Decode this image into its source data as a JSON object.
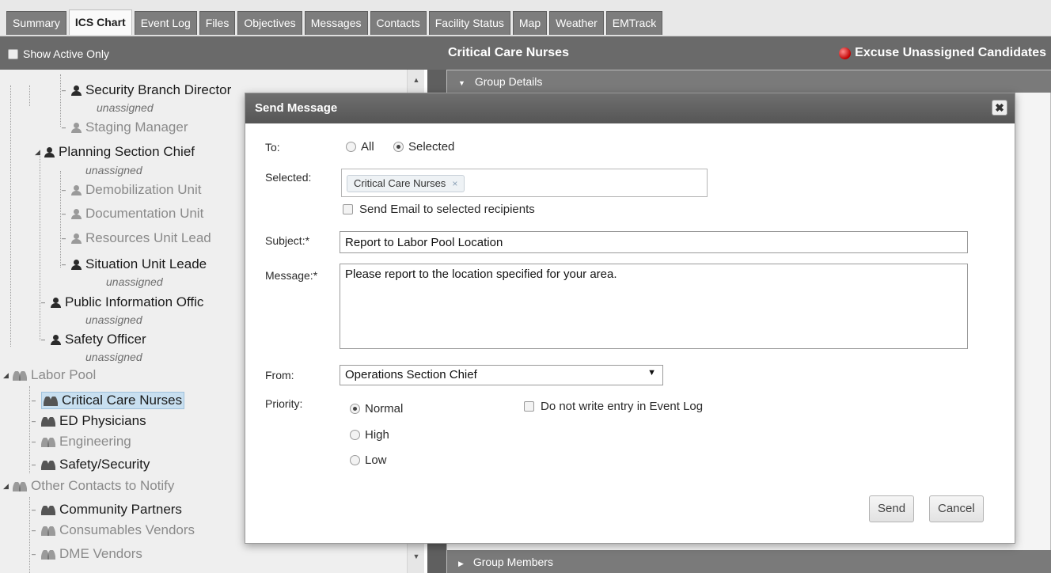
{
  "tabs": [
    {
      "label": "Summary",
      "active": false
    },
    {
      "label": "ICS Chart",
      "active": true
    },
    {
      "label": "Event Log",
      "active": false
    },
    {
      "label": "Files",
      "active": false
    },
    {
      "label": "Objectives",
      "active": false
    },
    {
      "label": "Messages",
      "active": false
    },
    {
      "label": "Contacts",
      "active": false
    },
    {
      "label": "Facility Status",
      "active": false
    },
    {
      "label": "Map",
      "active": false
    },
    {
      "label": "Weather",
      "active": false
    },
    {
      "label": "EMTrack",
      "active": false
    }
  ],
  "header": {
    "show_active_label": "Show Active Only",
    "group_title": "Critical Care Nurses",
    "excuse_label": "Excuse Unassigned Candidates"
  },
  "tree": {
    "unassigned": "unassigned",
    "nodes": {
      "security_branch": "Security Branch Director",
      "staging_manager": "Staging Manager",
      "planning_chief": "Planning Section Chief",
      "demob_unit": "Demobilization Unit",
      "documentation_unit": "Documentation Unit",
      "resources_unit": "Resources Unit Lead",
      "situation_unit": "Situation Unit Leade",
      "pio": "Public Information Offic",
      "safety_officer": "Safety Officer",
      "labor_pool": "Labor Pool",
      "critical_care": "Critical Care Nurses",
      "ed_physicians": "ED Physicians",
      "engineering": "Engineering",
      "safety_security": "Safety/Security",
      "other_contacts": "Other Contacts to Notify",
      "community_partners": "Community Partners",
      "consumables": "Consumables Vendors",
      "dme_vendors": "DME Vendors"
    }
  },
  "right_panel": {
    "group_details": "Group Details",
    "group_members": "Group Members"
  },
  "modal": {
    "title": "Send Message",
    "close_glyph": "✖",
    "to_label": "To:",
    "to_all": "All",
    "to_selected": "Selected",
    "selected_label": "Selected:",
    "selected_tag": "Critical Care Nurses",
    "tag_remove": "×",
    "send_email_label": "Send Email to selected recipients",
    "subject_label": "Subject:*",
    "subject_value": "Report to Labor Pool Location",
    "message_label": "Message:*",
    "message_value": "Please report to the location specified for your area.",
    "from_label": "From:",
    "from_value": "Operations Section Chief",
    "priority_label": "Priority:",
    "priority_normal": "Normal",
    "priority_high": "High",
    "priority_low": "Low",
    "no_log_label": "Do not write entry in Event Log",
    "send_button": "Send",
    "cancel_button": "Cancel"
  }
}
